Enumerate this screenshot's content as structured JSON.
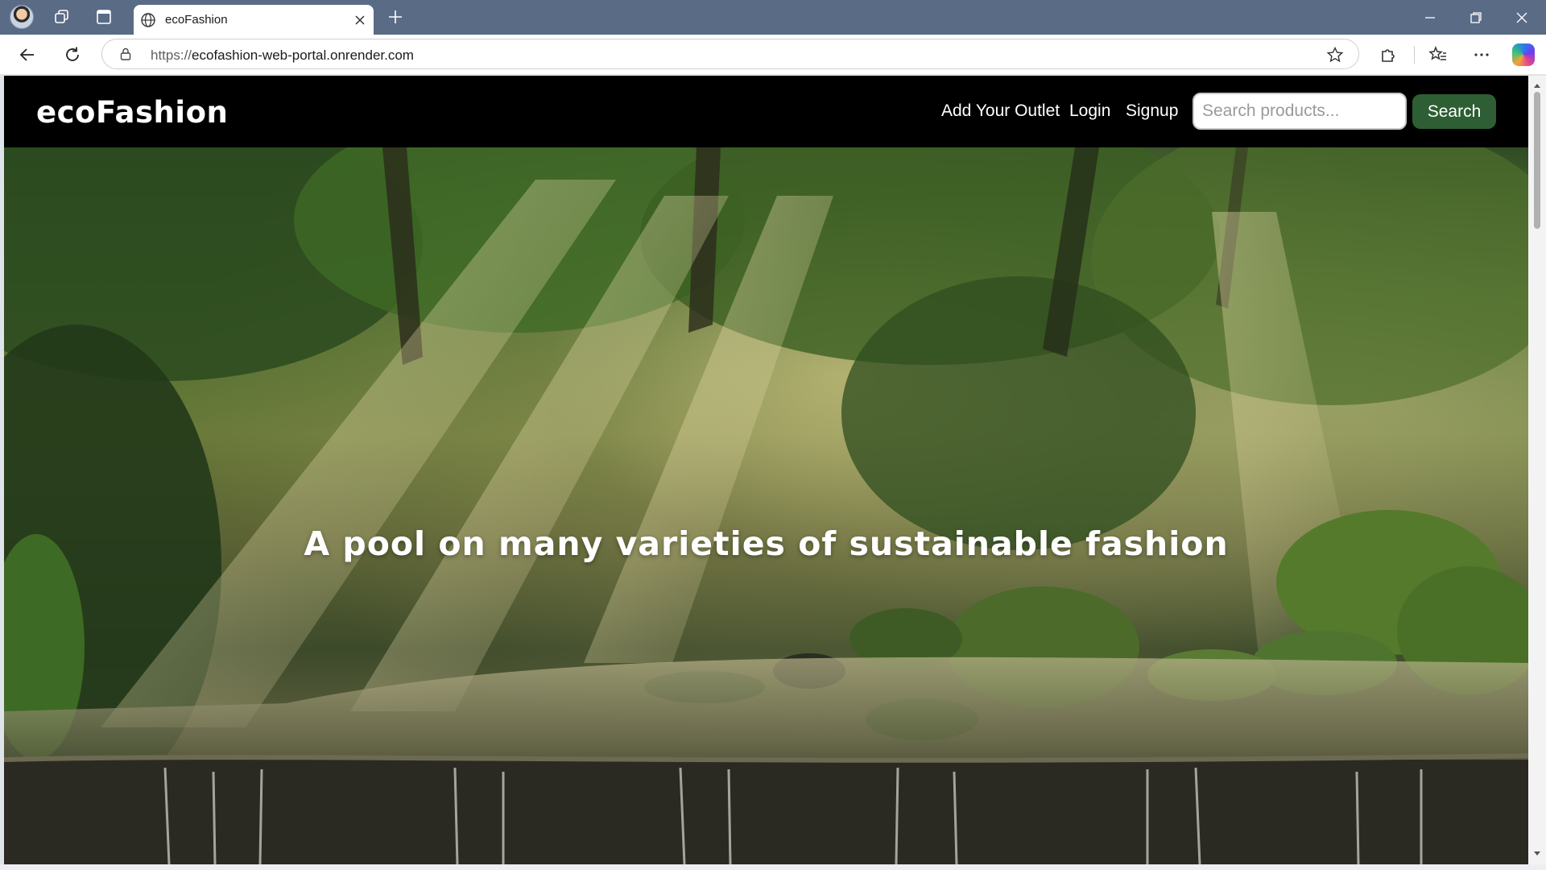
{
  "browser": {
    "tab": {
      "title": "ecoFashion",
      "icon": "globe-icon"
    },
    "address": {
      "scheme": "https://",
      "host": "ecofashion-web-portal.onrender.com"
    },
    "icons": {
      "profile": "profile-avatar",
      "workspaces": "workspaces-icon",
      "tab_actions": "tab-actions-icon",
      "new_tab": "plus-icon",
      "back": "back-arrow-icon",
      "refresh": "refresh-icon",
      "lock": "lock-icon",
      "favorite": "star-icon",
      "extensions": "puzzle-icon",
      "favorites": "favorites-icon",
      "more": "more-icon",
      "copilot": "copilot-icon"
    }
  },
  "site": {
    "brand": "ecoFashion",
    "nav": {
      "add_outlet": "Add Your Outlet",
      "login": "Login",
      "signup": "Signup"
    },
    "search": {
      "placeholder": "Search products...",
      "button": "Search"
    },
    "hero": {
      "title": "A pool on many varieties of sustainable fashion"
    },
    "colors": {
      "nav_bg": "#000000",
      "search_button": "#2e5e34"
    }
  }
}
